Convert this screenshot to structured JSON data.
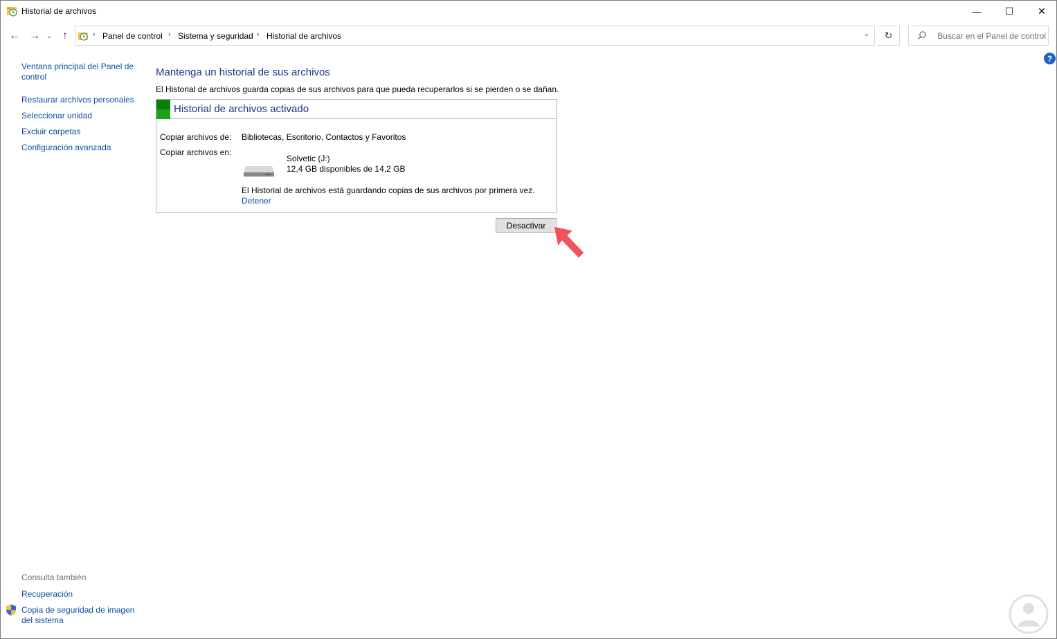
{
  "window": {
    "title": "Historial de archivos",
    "minimize_glyph": "—",
    "maximize_glyph": "☐",
    "close_glyph": "✕"
  },
  "navigation": {
    "back_glyph": "←",
    "forward_glyph": "→",
    "recent_glyph": "⌄",
    "up_glyph": "↑",
    "breadcrumb": [
      "Panel de control",
      "Sistema y seguridad",
      "Historial de archivos"
    ],
    "separator": "›",
    "dropdown_glyph": "⌄",
    "refresh_glyph": "↻",
    "search_placeholder": "Buscar en el Panel de control"
  },
  "sidebar": {
    "items": [
      "Ventana principal del Panel de control",
      "Restaurar archivos personales",
      "Seleccionar unidad",
      "Excluir carpetas",
      "Configuración avanzada"
    ],
    "see_also_title": "Consulta también",
    "see_also_items": [
      "Recuperación",
      "Copia de seguridad de imagen del sistema"
    ]
  },
  "main": {
    "title": "Mantenga un historial de sus archivos",
    "description": "El Historial de archivos guarda copias de sus archivos para que pueda recuperarlos si se pierden o se dañan.",
    "status": {
      "title": "Historial de archivos activado",
      "color": "#1aa31a",
      "copy_from_label": "Copiar archivos de:",
      "copy_from_value": "Bibliotecas, Escritorio, Contactos y Favoritos",
      "copy_to_label": "Copiar archivos en:",
      "drive_name": "Solvetic (J:)",
      "drive_space": "12,4 GB disponibles de 14,2 GB",
      "message": "El Historial de archivos está guardando copias de sus archivos por primera vez.",
      "stop_link": "Detener"
    },
    "deactivate_button": "Desactivar",
    "help_glyph": "?"
  },
  "colors": {
    "link": "#0b4ea2",
    "heading": "#1e3287",
    "arrow": "#f0535b"
  }
}
